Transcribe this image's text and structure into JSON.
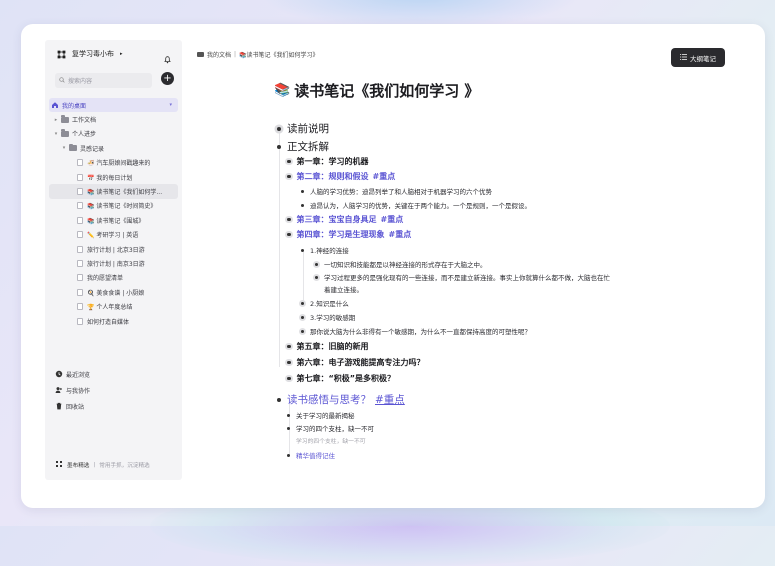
{
  "sidebar": {
    "app_name": "复学习毒小布",
    "search_placeholder": "搜索内容",
    "add_label": "+",
    "home_item": "我的桌面",
    "tree": [
      {
        "label": "工作文档",
        "type": "folder",
        "level": 1,
        "caret": "▸"
      },
      {
        "label": "个人进步",
        "type": "folder",
        "level": 1,
        "caret": "▾"
      },
      {
        "label": "灵感记录",
        "type": "folder",
        "level": 2,
        "caret": "▾"
      },
      {
        "label": "🍜 汽车厨娘间戳趣来的",
        "type": "doc",
        "level": 3
      },
      {
        "label": "📅 我的每日计划",
        "type": "doc",
        "level": 3
      },
      {
        "label": "📚 读书笔记《我们如何学...",
        "type": "doc",
        "level": 3,
        "selected": true
      },
      {
        "label": "📚 读书笔记《时间简史》",
        "type": "doc",
        "level": 3
      },
      {
        "label": "📚 读书笔记《围城》",
        "type": "doc",
        "level": 3
      },
      {
        "label": "✏️ 考研学习 | 英语",
        "type": "doc",
        "level": 3
      },
      {
        "label": "旅行计划 | 北京3日游",
        "type": "doc",
        "level": 3
      },
      {
        "label": "旅行计划 | 南京3日游",
        "type": "doc",
        "level": 3
      },
      {
        "label": "我的愿望清单",
        "type": "doc",
        "level": 3
      },
      {
        "label": "🍳 美食食谱 | 小厨娘",
        "type": "doc",
        "level": 3
      },
      {
        "label": "🏆 个人年度总结",
        "type": "doc",
        "level": 3
      },
      {
        "label": "如何打造自媒体",
        "type": "doc",
        "level": 3
      }
    ],
    "sections": [
      {
        "label": "最近浏览",
        "icon": "clock-icon"
      },
      {
        "label": "与我协作",
        "icon": "users-icon"
      },
      {
        "label": "回收站",
        "icon": "trash-icon"
      }
    ],
    "footer_brand": "墨布精选",
    "footer_tagline": "常用手抓，沉淀精选"
  },
  "header": {
    "breadcrumb_root": "我的文档",
    "breadcrumb_sep": "|",
    "breadcrumb_current": "📚读书笔记《我们如何学习》",
    "outline_button": "大纲笔记"
  },
  "doc": {
    "title_emoji": "📚",
    "title": "读书笔记《我们如何学习 》",
    "blocks": {
      "s1": "读前说明",
      "s2": "正文拆解",
      "c1": "第一章：学习的机器",
      "c2": "第二章：规则和假设",
      "c2_tag": "#重点",
      "c2_p1": "人脑的学习优势：迪昂列举了和人脑相对于机器学习的六个优势",
      "c2_p2": "迪昂认为，人脑学习的优势，关键在于两个能力。一个是规则，一个是假设。",
      "c3": "第三章：宝宝自身具足",
      "c3_tag": "#重点",
      "c4": "第四章：学习是生理现象",
      "c4_tag": "#重点",
      "c4_p1": "1.神经的连接",
      "c4_p1a": "一切知识和技能都是以神经连接的形式存在于大脑之中。",
      "c4_p1b": "学习过程更多的是强化现有的一些连接，而不是建立新连接。事实上你就算什么都不做，大脑也在忙",
      "c4_p1b2": "着建立连接。",
      "c4_p2": "2.知识是什么",
      "c4_p3": "3.学习的敏感期",
      "c4_p4": "那你说大脑为什么非得有一个敏感期，为什么不一直都保持高度的可塑性呢？",
      "c5": "第五章：旧脑的新用",
      "c6": "第六章：电子游戏能提高专注力吗？",
      "c7": "第七章：“积极”是多积极？",
      "s3": "读书感悟与思考？",
      "s3_tag": "#重点",
      "r1": "关于学习的最新揭秘",
      "r2": "学习的四个支柱，缺一不可",
      "r2_note": "学习的四个支柱，缺一不可",
      "r3": "精华值得记住"
    }
  },
  "colors": {
    "accent": "#5b55d3",
    "dark_button": "#2a2a2e",
    "sidebar_bg": "#f4f4f6",
    "selected_bg": "#e4e3f6"
  }
}
